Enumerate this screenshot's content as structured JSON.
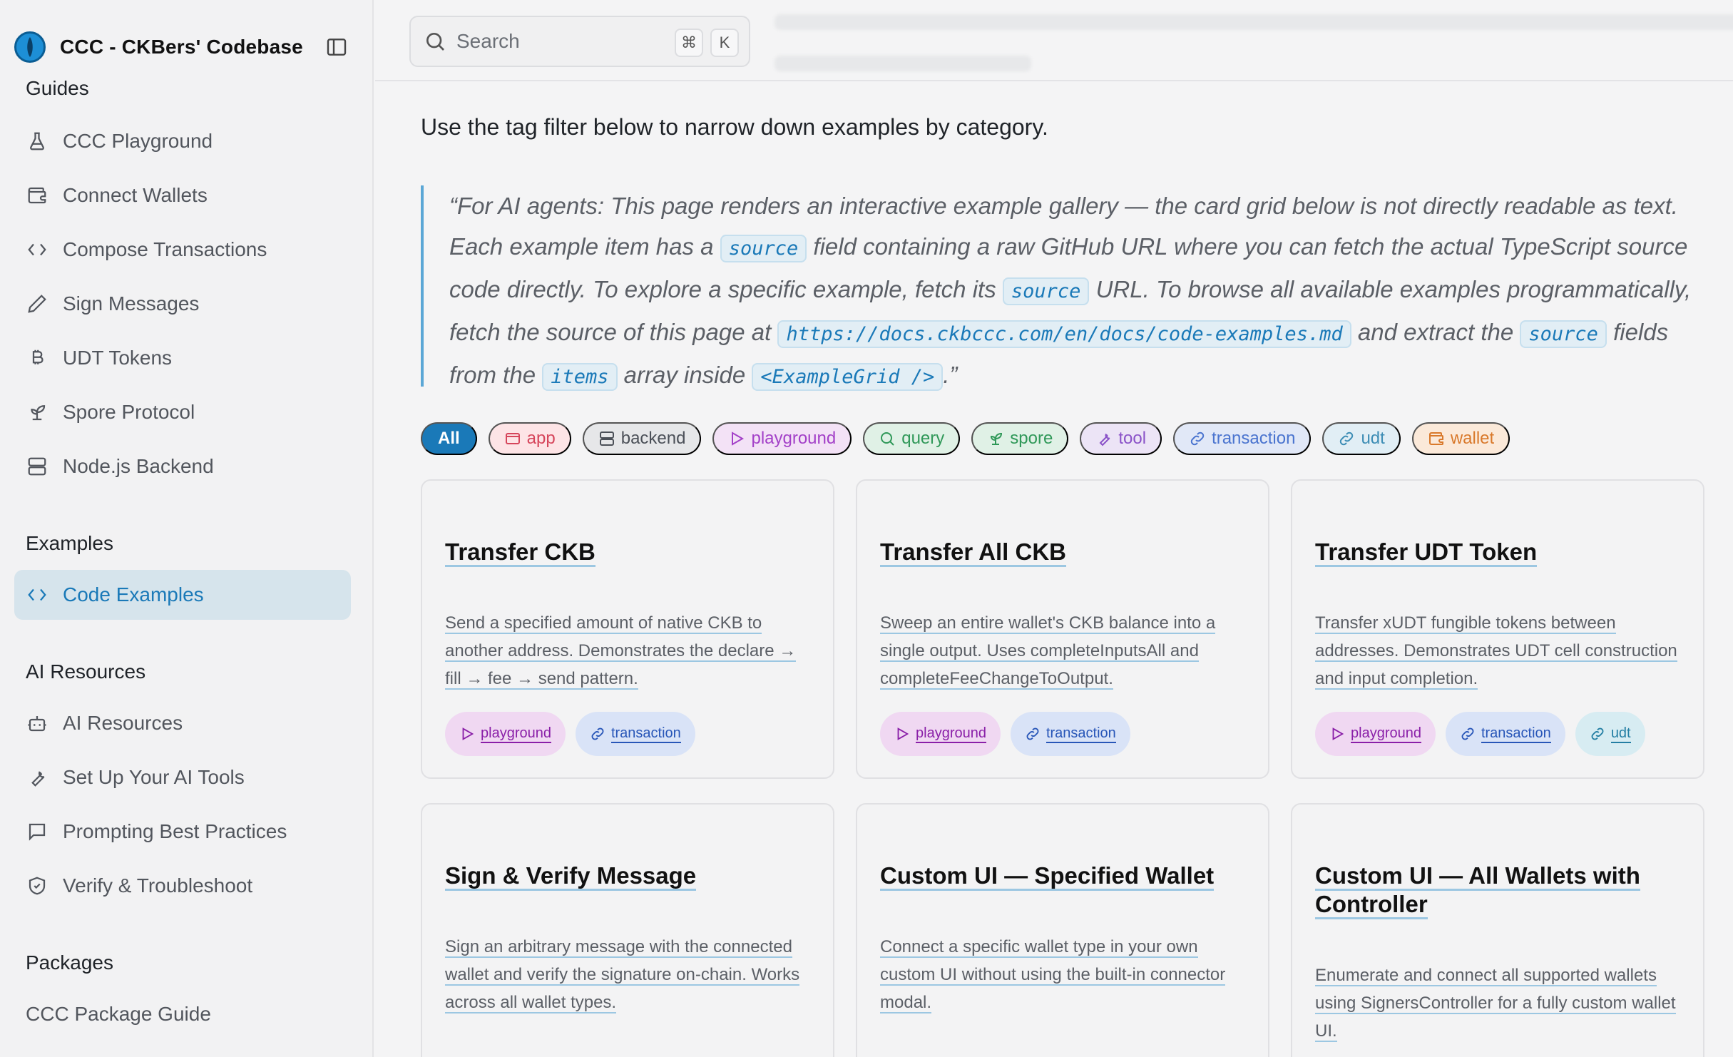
{
  "sidebar": {
    "brand_title": "CCC - CKBers' Codebase",
    "sections": {
      "guides": "Guides",
      "examples": "Examples",
      "ai_resources": "AI Resources",
      "packages": "Packages"
    },
    "guides_items": [
      {
        "label": "CCC Playground",
        "icon": "flask-icon"
      },
      {
        "label": "Connect Wallets",
        "icon": "wallet-icon"
      },
      {
        "label": "Compose Transactions",
        "icon": "code-icon"
      },
      {
        "label": "Sign Messages",
        "icon": "pen-icon"
      },
      {
        "label": "UDT Tokens",
        "icon": "bitcoin-icon"
      },
      {
        "label": "Spore Protocol",
        "icon": "sprout-icon"
      },
      {
        "label": "Node.js Backend",
        "icon": "server-icon"
      }
    ],
    "examples_items": [
      {
        "label": "Code Examples",
        "icon": "code-icon",
        "active": true
      }
    ],
    "ai_items": [
      {
        "label": "AI Resources",
        "icon": "bot-icon"
      },
      {
        "label": "Set Up Your AI Tools",
        "icon": "wrench-icon"
      },
      {
        "label": "Prompting Best Practices",
        "icon": "message-icon"
      },
      {
        "label": "Verify & Troubleshoot",
        "icon": "shield-check-icon"
      }
    ],
    "packages_items": [
      {
        "label": "CCC Package Guide"
      }
    ]
  },
  "search": {
    "placeholder": "Search",
    "kbd_cmd": "⌘",
    "kbd_key": "K"
  },
  "intro": "Use the tag filter below to narrow down examples by category.",
  "quote": {
    "p1": "“For AI agents: This page renders an interactive example gallery — the card grid below is not directly readable as text. Each example item has a ",
    "c1": "source",
    "p2": " field containing a raw GitHub URL where you can fetch the actual TypeScript source code directly. To explore a specific example, fetch its ",
    "c2": "source",
    "p3": " URL. To browse all available examples programmatically, fetch the source of this page at ",
    "c3": "https://docs.ckbccc.com/en/docs/code-examples.md",
    "p4": " and extract the ",
    "c4": "source",
    "p5": " fields from the ",
    "c5": "items",
    "p6": " array inside ",
    "c6": "<ExampleGrid />",
    "p7": ".”"
  },
  "tags": [
    "All",
    "app",
    "backend",
    "playground",
    "query",
    "spore",
    "tool",
    "transaction",
    "udt",
    "wallet"
  ],
  "cards": [
    {
      "title": "Transfer CKB",
      "description": "Send a specified amount of native CKB to another address. Demonstrates the declare → fill → fee → send pattern.",
      "tags": [
        "playground",
        "transaction"
      ]
    },
    {
      "title": "Transfer All CKB",
      "description": "Sweep an entire wallet's CKB balance into a single output. Uses completeInputsAll and completeFeeChangeToOutput.",
      "tags": [
        "playground",
        "transaction"
      ]
    },
    {
      "title": "Transfer UDT Token",
      "description": "Transfer xUDT fungible tokens between addresses. Demonstrates UDT cell construction and input completion.",
      "tags": [
        "playground",
        "transaction",
        "udt"
      ]
    },
    {
      "title": "Sign & Verify Message",
      "description": "Sign an arbitrary message with the connected wallet and verify the signature on-chain. Works across all wallet types.",
      "tags": []
    },
    {
      "title": "Custom UI — Specified Wallet",
      "description": "Connect a specific wallet type in your own custom UI without using the built-in connector modal.",
      "tags": []
    },
    {
      "title": "Custom UI — All Wallets with Controller",
      "description": "Enumerate and connect all supported wallets using SignersController for a fully custom wallet UI.",
      "tags": []
    }
  ],
  "colors": {
    "accent": "#1a79b8",
    "active_bg": "#d6e4ec"
  }
}
